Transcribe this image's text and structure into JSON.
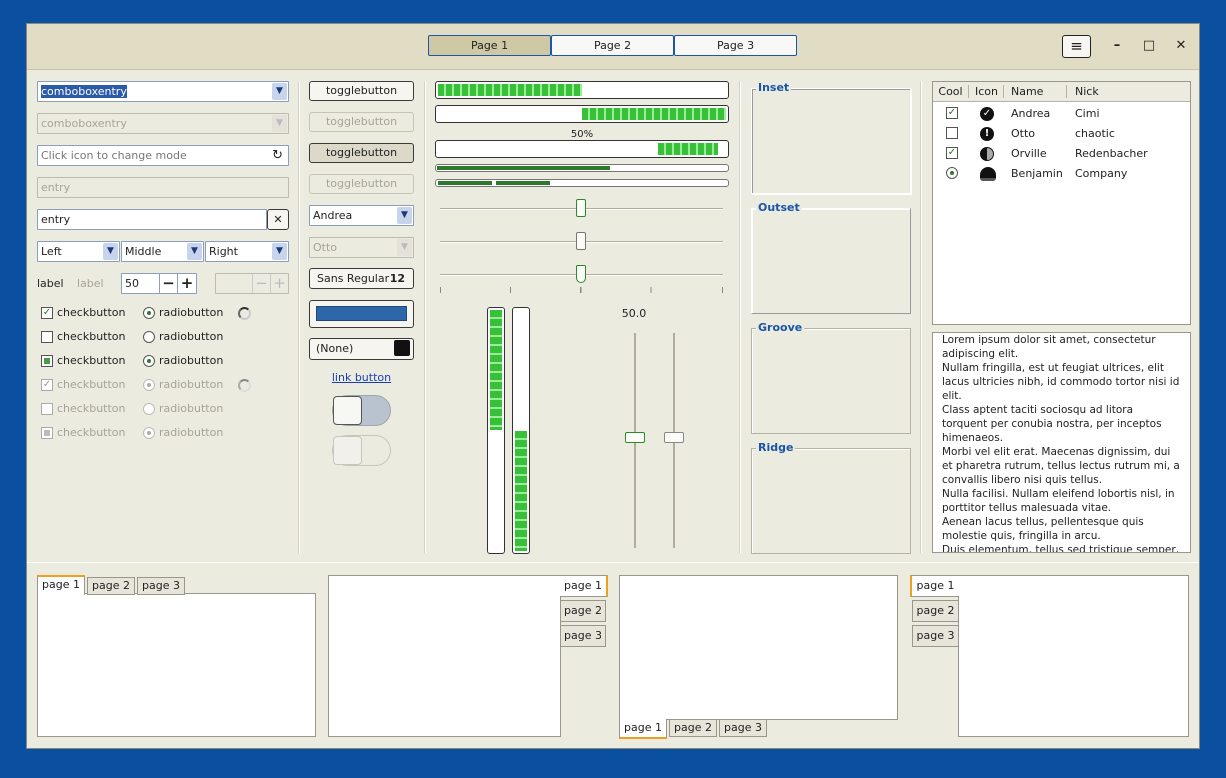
{
  "header": {
    "stack": [
      "Page 1",
      "Page 2",
      "Page 3"
    ],
    "menu_icon": "hamburger-icon",
    "buttons": [
      "minimize",
      "maximize",
      "close"
    ]
  },
  "left": {
    "combo1": "comboboxentry",
    "combo2": "comboboxentry",
    "entry_mode_placeholder": "Click icon to change mode",
    "entry_disabled": "entry",
    "entry": "entry",
    "combos": [
      "Left",
      "Middle",
      "Right"
    ],
    "label": "label",
    "label_disabled": "label",
    "spin_value": "50",
    "checks": [
      "checkbutton",
      "checkbutton",
      "checkbutton",
      "checkbutton",
      "checkbutton",
      "checkbutton"
    ],
    "radios": [
      "radiobutton",
      "radiobutton",
      "radiobutton",
      "radiobutton",
      "radiobutton",
      "radiobutton"
    ]
  },
  "mid": {
    "toggles": [
      "togglebutton",
      "togglebutton",
      "togglebutton",
      "togglebutton"
    ],
    "combo_andrea": "Andrea",
    "combo_otto": "Otto",
    "font_name": "Sans Regular",
    "font_size": "12",
    "file_none": "(None)",
    "link": "link button"
  },
  "progress": {
    "percent_label": "50%",
    "scale_value": "50.0",
    "bars": [
      0.34,
      0.34,
      0.6,
      0.25
    ],
    "vbars": [
      0.5,
      0.5
    ],
    "hscales": [
      0.5,
      0.5,
      0.5
    ],
    "vscales": [
      0.5,
      0.5
    ]
  },
  "frames": [
    "Inset",
    "Outset",
    "Groove",
    "Ridge"
  ],
  "tree": {
    "columns": [
      "Cool",
      "Icon",
      "Name",
      "Nick"
    ],
    "rows": [
      {
        "name": "Andrea",
        "nick": "Cimi",
        "icon": "check-circle-icon"
      },
      {
        "name": "Otto",
        "nick": "chaotic",
        "icon": "exclamation-circle-icon"
      },
      {
        "name": "Orville",
        "nick": "Redenbacher",
        "icon": "half-moon-icon"
      },
      {
        "name": "Benjamin",
        "nick": "Company",
        "icon": "hat-icon"
      }
    ]
  },
  "text": "Lorem ipsum dolor sit amet, consectetur adipiscing elit.\nNullam fringilla, est ut feugiat ultrices, elit lacus ultricies nibh, id commodo tortor nisi id elit.\nClass aptent taciti sociosqu ad litora torquent per conubia nostra, per inceptos himenaeos.\nMorbi vel elit erat. Maecenas dignissim, dui et pharetra rutrum, tellus lectus rutrum mi, a convallis libero nisi quis tellus.\nNulla facilisi. Nullam eleifend lobortis nisl, in porttitor tellus malesuada vitae.\nAenean lacus tellus, pellentesque quis molestie quis, fringilla in arcu.\nDuis elementum, tellus sed tristique semper, metus metus accumsan augue, et porttitor augue orci a libero.",
  "notebooks": [
    [
      "page 1",
      "page 2",
      "page 3"
    ],
    [
      "page 1",
      "page 2",
      "page 3"
    ],
    [
      "page 1",
      "page 2",
      "page 3"
    ],
    [
      "page 1",
      "page 2",
      "page 3"
    ]
  ]
}
